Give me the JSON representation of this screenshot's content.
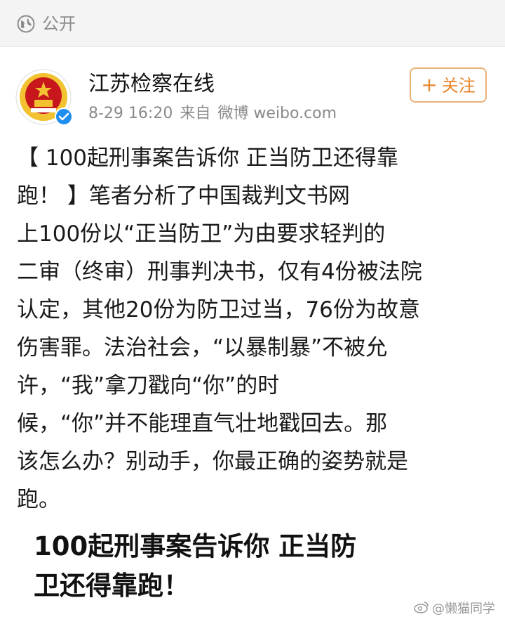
{
  "visibility": {
    "label": "公开",
    "icon": "globe-icon"
  },
  "post": {
    "author": "江苏检察在线",
    "date": "8-29 16:20",
    "source_prefix": "来自",
    "source": "微博 weibo.com",
    "follow_label": "关注",
    "verified_icon": "verified-badge-icon",
    "text_lines": [
      "【 100起刑事案告诉你 正当防卫还得靠",
      "跑！ 】笔者分析了中国裁判文书网",
      "上100份以“正当防卫”为由要求轻判的",
      "二审（终审）刑事判决书，仅有4份被法院",
      "认定，其他20份为防卫过当，76份为故意",
      "伤害罪。法治社会，“以暴制暴”不被允",
      "许，“我”拿刀戳向“你”的时",
      "候，“你”并不能理直气壮地戳回去。那",
      "该怎么办？别动手，你最正确的姿势就是",
      "跑。"
    ],
    "headline_lines": [
      "100起刑事案告诉你 正当防",
      "卫还得靠跑！"
    ]
  },
  "watermark": "@懒猫同学",
  "colors": {
    "follow_accent": "#e8862a",
    "verified_blue": "#1f8ef1",
    "emblem_red": "#c8161d",
    "emblem_gold": "#f2c230"
  }
}
